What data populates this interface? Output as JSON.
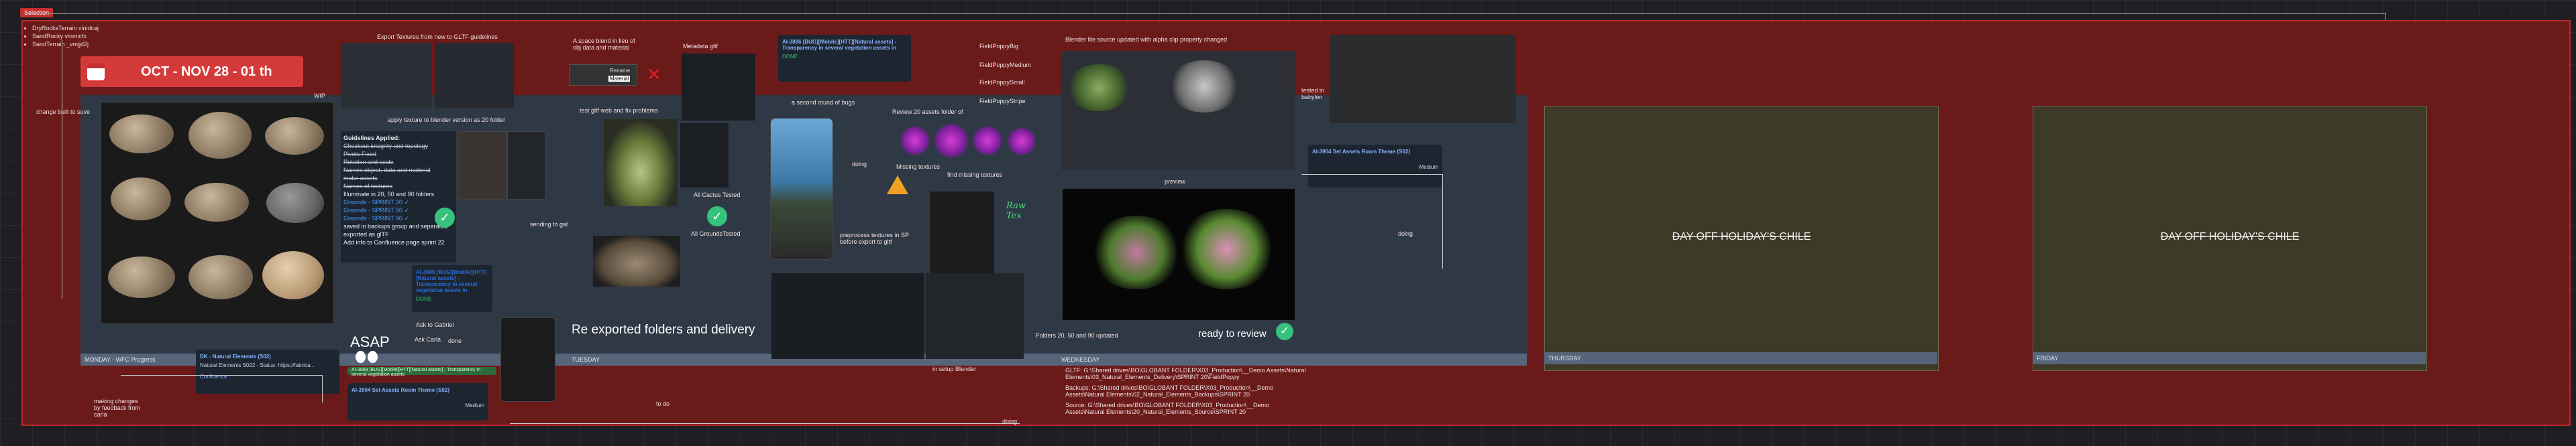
{
  "selection_tag": "Selection",
  "header_bullets": [
    "DryRocksTerrain vinidcaj",
    "SandRocky vinmicfx",
    "SandTerrain _vmjjd2j"
  ],
  "banner": {
    "date": "OCT - NOV 28 - 01 th",
    "icon": "calendar-icon"
  },
  "columns": [
    {
      "key": "monday",
      "label": "MONDAY - WFC Progress"
    },
    {
      "key": "tuesday",
      "label": "TUESDAY"
    },
    {
      "key": "wednesday",
      "label": "WEDNESDAY"
    },
    {
      "key": "thursday",
      "label": "THURSDAY"
    },
    {
      "key": "friday",
      "label": "FRIDAY"
    }
  ],
  "notes": {
    "wip": "WIP",
    "change_built": "change built to suve",
    "export_fixes": "Export Textures from new to GLTF guidelines",
    "apply_texture": "apply texture to blender version as 20 folder",
    "sending_gabriel": "sending to gabriel",
    "ask_gabriel": "Ask to Gabriel",
    "done1": "done",
    "ask_carla": "Ask Carla",
    "asap": "ASAP",
    "making_changes": "making changes by feedback from carla",
    "to_do": "to do",
    "space_blend": "A space blend in lieu of obj data and material",
    "metadata_gltf": "Metadata gltf",
    "test_gltf": "test gltf web and fix problems",
    "all_cactus": "All Cactus Tested",
    "all_grounds": "All GroundsTested",
    "exported": "Re exported folders and delivery",
    "second_round": "a second round of bugs",
    "doing1": "doing",
    "review_20": "Review 20 assets folder of",
    "missing_textures": "Missing textures",
    "find_missing": "find missing textures",
    "preprocess": "preprocess textures in SP before export to gltf",
    "fixed_poppy_big": "FieldPoppyBig",
    "fixed_poppy_medium": "FieldPoppyMedium",
    "fixed_poppy_small": "FieldPoppySmall",
    "fixed_poppy_stripe": "FieldPoppyStripe",
    "blender_source": "Blender file source updated with alpha clip property changed",
    "preview": "preview",
    "tested_babylon": "tested in babylon",
    "folders_updated": "Folders 20, 50 and 90 updated",
    "ready_review": "ready to review",
    "doing2": "doing",
    "doing3": "doing",
    "in_setup": "in setup Blender"
  },
  "guidelines": {
    "title": "Guidelines Applied:",
    "items": [
      {
        "text": "Checkout integrity and topology",
        "style": "st"
      },
      {
        "text": "Pivots Fixed",
        "style": "st"
      },
      {
        "text": "Rotation and scale",
        "style": "st"
      },
      {
        "text": "Names object, data and material",
        "style": "st"
      },
      {
        "text": "make assets",
        "style": "st"
      },
      {
        "text": "Names of textures",
        "style": "st"
      },
      {
        "text": "Illuminate in 20, 50 and 90 folders",
        "style": "n"
      },
      {
        "text": "Grounds - SPRINT 20 ✓",
        "style": "bl"
      },
      {
        "text": "Grounds - SPRINT 50 ✓",
        "style": "bl"
      },
      {
        "text": "Grounds - SPRINT 90 ✓",
        "style": "bl"
      },
      {
        "text": "saved in backups group and separated",
        "style": "n"
      },
      {
        "text": "exported as glTF",
        "style": "n"
      },
      {
        "text": "Add info to Confluence page sprint 22",
        "style": "n"
      }
    ]
  },
  "cards": {
    "ticket1": "AI-3886 [BUG][Mobile][HTT][Natural assets] - Transparency in several vegetation assets in",
    "ticket1_status": "DONE",
    "ticket2": "AI-3886 [BUG][Mobile][HTT][Natural assets] - Transparency in several vegetation assets in",
    "ticket2_status": "DONE",
    "ticket3": "AI-3889 [BUG][Mobile][HTT][Natural assets] - Transparency in several vegetation assets",
    "ticket3_status": "DONE",
    "dk": "DK - Natural Elements (S02)",
    "dk_sub": "Natural Elements S022 - Status: https://fabrica...",
    "dk_link": "Confluence",
    "set_assets1": "AI-3904 Set Assets Room Theme (S02)",
    "set_assets2": "AI-3904 Set Assets Room Theme (S02)",
    "medium": "Medium",
    "priority": "Medium",
    "todo": "To Do"
  },
  "paths": {
    "gltf": "GLTF: G:\\Shared drives\\BO\\GLOBANT FOLDER\\X03_Production\\__Demo Assets\\Natural Elements\\03_Natural_Elements_Delivery\\SPRINT 20\\FieldPoppy",
    "backups": "Backups: G:\\Shared drives\\BO\\GLOBANT FOLDER\\X03_Production\\__Demo Assets\\Natural Elements\\02_Natural_Elements_Backups\\SPRINT 20",
    "source": "Source: G:\\Shared drives\\BO\\GLOBANT FOLDER\\X03_Production\\__Demo Assets\\Natural Elements\\20_Natural_Elements_Source\\SPRINT 20"
  },
  "popup": {
    "rename": "Rename",
    "material": "Material",
    "cancel": "Cancel"
  },
  "holiday_label": "DAY OFF HOLIDAY'S CHILE",
  "handwritten": "Raw Tex"
}
